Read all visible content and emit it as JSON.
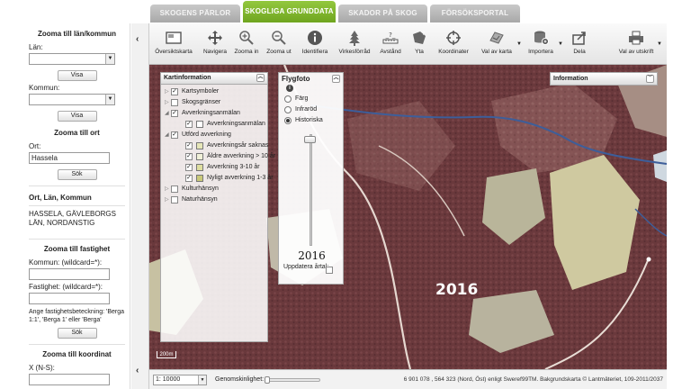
{
  "tabs": [
    {
      "label": "SKOGENS PÄRLOR",
      "active": false
    },
    {
      "label": "SKOGLIGA GRUNDDATA",
      "active": true
    },
    {
      "label": "SKADOR PÅ SKOG",
      "active": false
    },
    {
      "label": "FÖRSÖKSPORTAL",
      "active": false
    }
  ],
  "left_panel": {
    "zoom_county": {
      "title": "Zooma till län/kommun",
      "county_label": "Län:",
      "county_value": "",
      "municipality_label": "Kommun:",
      "municipality_value": "",
      "show_label": "Visa"
    },
    "zoom_place": {
      "title": "Zooma till ort",
      "place_label": "Ort:",
      "place_value": "Hassela",
      "search_label": "Sök"
    },
    "result": {
      "header": "Ort, Län, Kommun",
      "place": "HASSELA, GÄVLEBORGS LÄN, NORDANSTIG"
    },
    "zoom_property": {
      "title": "Zooma till fastighet",
      "municipality_label": "Kommun: (wildcard=*):",
      "property_label": "Fastighet: (wildcard=*):",
      "hint": "Ange fastighetsbeteckning: 'Berga 1:1', 'Berga 1' eller 'Berga'",
      "search_label": "Sök"
    },
    "zoom_coord": {
      "title": "Zooma till koordinat",
      "x_label": "X (N-S):"
    }
  },
  "toolbar": [
    {
      "label": "Översiktskarta",
      "icon": "overview-map-icon"
    },
    {
      "label": "Navigera",
      "icon": "pan-arrows-icon"
    },
    {
      "label": "Zooma in",
      "icon": "zoom-in-icon"
    },
    {
      "label": "Zooma ut",
      "icon": "zoom-out-icon"
    },
    {
      "label": "Identifiera",
      "icon": "info-icon"
    },
    {
      "label": "Virkesförråd",
      "icon": "tree-icon"
    },
    {
      "label": "Avstånd",
      "icon": "ruler-icon"
    },
    {
      "label": "Yta",
      "icon": "area-icon"
    },
    {
      "label": "Koordinater",
      "icon": "crosshair-icon"
    },
    {
      "label": "Val av karta",
      "icon": "map-select-icon"
    },
    {
      "label": "Importera",
      "icon": "database-import-icon"
    },
    {
      "label": "Dela",
      "icon": "share-icon"
    },
    {
      "label": "Val av utskrift",
      "icon": "printer-icon"
    }
  ],
  "layer_panel": {
    "title": "Kartinformation",
    "layers": [
      {
        "label": "Kartsymboler",
        "checked": true,
        "level": 0,
        "expander": "▷",
        "swatch": ""
      },
      {
        "label": "Skogsgränser",
        "checked": false,
        "level": 0,
        "expander": "▷",
        "swatch": ""
      },
      {
        "label": "Avverkningsanmälan",
        "checked": true,
        "level": 0,
        "expander": "◢",
        "swatch": ""
      },
      {
        "label": "Avverkningsanmälan",
        "checked": true,
        "level": 1,
        "expander": "",
        "swatch": "#ffffff"
      },
      {
        "label": "Utförd avverkning",
        "checked": true,
        "level": 0,
        "expander": "◢",
        "swatch": ""
      },
      {
        "label": "Avverkningsår saknas",
        "checked": true,
        "level": 1,
        "expander": "",
        "swatch": "#e6e6b8"
      },
      {
        "label": "Äldre avverkning > 10 år",
        "checked": true,
        "level": 1,
        "expander": "",
        "swatch": "#f0f0d8"
      },
      {
        "label": "Avverkning 3-10 år",
        "checked": true,
        "level": 1,
        "expander": "",
        "swatch": "#dedea0"
      },
      {
        "label": "Nyligt avverkning 1-3 år",
        "checked": true,
        "level": 1,
        "expander": "",
        "swatch": "#c9c97a"
      },
      {
        "label": "Kulturhänsyn",
        "checked": false,
        "level": 0,
        "expander": "▷",
        "swatch": ""
      },
      {
        "label": "Naturhänsyn",
        "checked": false,
        "level": 0,
        "expander": "▷",
        "swatch": ""
      }
    ]
  },
  "photo_panel": {
    "title": "Flygfoto",
    "options": [
      {
        "label": "Färg",
        "selected": false
      },
      {
        "label": "Infraröd",
        "selected": false
      },
      {
        "label": "Historiska",
        "selected": true
      }
    ],
    "year": "2016",
    "update_label": "Uppdatera årtal:"
  },
  "info_panel": {
    "title": "Information"
  },
  "map": {
    "year_overlay": "2016",
    "scale_text": "200m"
  },
  "bottom_bar": {
    "scale_value": "1: 10000",
    "opacity_label": "Genomskinlighet:",
    "opacity_value": 0,
    "coords_text": "6 901 078 , 564 323 (Nord, Öst) enligt Sweref99TM. Bakgrundskarta © Lantmäteriet, 109-2011/2037"
  },
  "colors": {
    "active_tab": "#7cb52c",
    "forest": "#6d3b3e",
    "clearcut": "#c8c39a",
    "river": "#4a6aa8"
  }
}
